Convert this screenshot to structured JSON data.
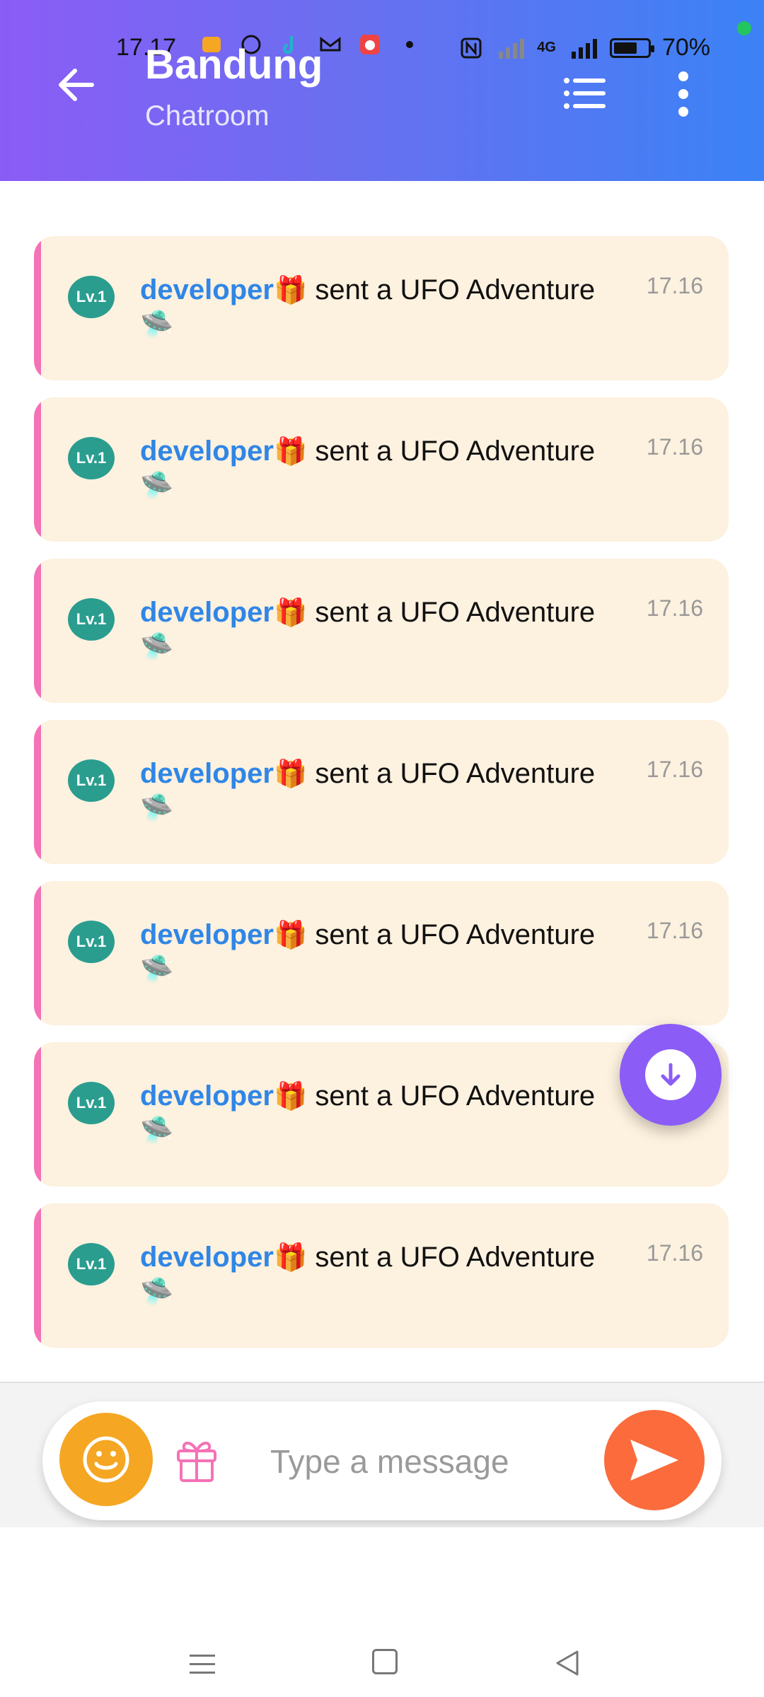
{
  "status": {
    "time": "17.17",
    "network": "4G",
    "battery": "70%",
    "battery_level": 0.7
  },
  "header": {
    "title": "Bandung",
    "subtitle": "Chatroom"
  },
  "messages": [
    {
      "level": "Lv.1",
      "user": "developer",
      "gift_emoji": "🎁",
      "text": " sent a UFO Adventure",
      "item_emoji": "🛸",
      "time": "17.16"
    },
    {
      "level": "Lv.1",
      "user": "developer",
      "gift_emoji": "🎁",
      "text": " sent a UFO Adventure",
      "item_emoji": "🛸",
      "time": "17.16"
    },
    {
      "level": "Lv.1",
      "user": "developer",
      "gift_emoji": "🎁",
      "text": " sent a UFO Adventure",
      "item_emoji": "🛸",
      "time": "17.16"
    },
    {
      "level": "Lv.1",
      "user": "developer",
      "gift_emoji": "🎁",
      "text": " sent a UFO Adventure",
      "item_emoji": "🛸",
      "time": "17.16"
    },
    {
      "level": "Lv.1",
      "user": "developer",
      "gift_emoji": "🎁",
      "text": " sent a UFO Adventure",
      "item_emoji": "🛸",
      "time": "17.16"
    },
    {
      "level": "Lv.1",
      "user": "developer",
      "gift_emoji": "🎁",
      "text": " sent a UFO Adventure",
      "item_emoji": "🛸",
      "time": ""
    },
    {
      "level": "Lv.1",
      "user": "developer",
      "gift_emoji": "🎁",
      "text": " sent a UFO Adventure",
      "item_emoji": "🛸",
      "time": "17.16"
    }
  ],
  "composer": {
    "placeholder": "Type a message"
  },
  "colors": {
    "header_start": "#8b5cf6",
    "header_end": "#3b82f6",
    "message_bg": "#fdf1df",
    "accent_pink": "#f472b6",
    "username": "#2f86e6",
    "level_badge": "#2a9d8f",
    "emoji_button": "#f5a623",
    "send_button": "#fb6b3c",
    "scroll_button": "#8b5cf6"
  },
  "icons": {
    "back": "arrow-left-icon",
    "list": "list-icon",
    "more": "more-vertical-icon",
    "scroll": "arrow-down-circle-icon",
    "emoji": "smiley-icon",
    "gift": "gift-icon",
    "send": "send-icon"
  }
}
